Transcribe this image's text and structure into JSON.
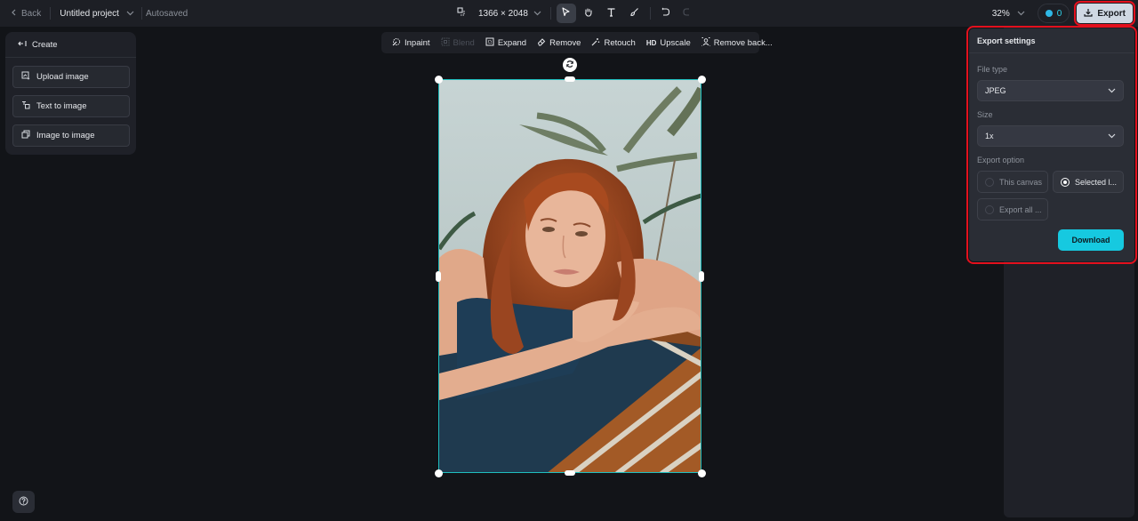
{
  "topbar": {
    "back_label": "Back",
    "project_title": "Untitled project",
    "autosave_status": "Autosaved",
    "dimensions": "1366 × 2048",
    "zoom_level": "32%",
    "credits": "0",
    "export_label": "Export"
  },
  "tools": [
    {
      "name": "select",
      "icon": "cursor-arrow-icon",
      "active": true
    },
    {
      "name": "hand",
      "icon": "hand-icon",
      "active": false
    },
    {
      "name": "text",
      "icon": "text-icon",
      "active": false
    },
    {
      "name": "brush",
      "icon": "brush-icon",
      "active": false
    },
    {
      "name": "undo",
      "icon": "undo-icon",
      "active": false
    },
    {
      "name": "redo",
      "icon": "redo-icon",
      "active": false
    }
  ],
  "create_panel": {
    "title": "Create",
    "items": [
      {
        "label": "Upload image",
        "icon": "upload-image-icon"
      },
      {
        "label": "Text to image",
        "icon": "text-to-image-icon"
      },
      {
        "label": "Image to image",
        "icon": "image-to-image-icon"
      }
    ]
  },
  "edit_toolbar": {
    "items": [
      {
        "label": "Inpaint",
        "icon": "inpaint-icon",
        "disabled": false
      },
      {
        "label": "Blend",
        "icon": "blend-icon",
        "disabled": true
      },
      {
        "label": "Expand",
        "icon": "expand-icon",
        "disabled": false
      },
      {
        "label": "Remove",
        "icon": "eraser-icon",
        "disabled": false
      },
      {
        "label": "Retouch",
        "icon": "magic-wand-icon",
        "disabled": false
      },
      {
        "label": "Upscale",
        "icon": "hd-icon",
        "icon_text": "HD",
        "disabled": false
      },
      {
        "label": "Remove back...",
        "icon": "remove-background-icon",
        "disabled": false
      }
    ]
  },
  "export_settings": {
    "title": "Export settings",
    "file_type_label": "File type",
    "file_type_value": "JPEG",
    "size_label": "Size",
    "size_value": "1x",
    "export_option_label": "Export option",
    "options": [
      {
        "label": "This canvas",
        "selected": false
      },
      {
        "label": "Selected l...",
        "selected": true
      },
      {
        "label": "Export all ...",
        "selected": false
      }
    ],
    "download_label": "Download"
  },
  "colors": {
    "accent": "#16c9e0",
    "selection": "#1fbfbf",
    "highlight": "#e3101d"
  }
}
